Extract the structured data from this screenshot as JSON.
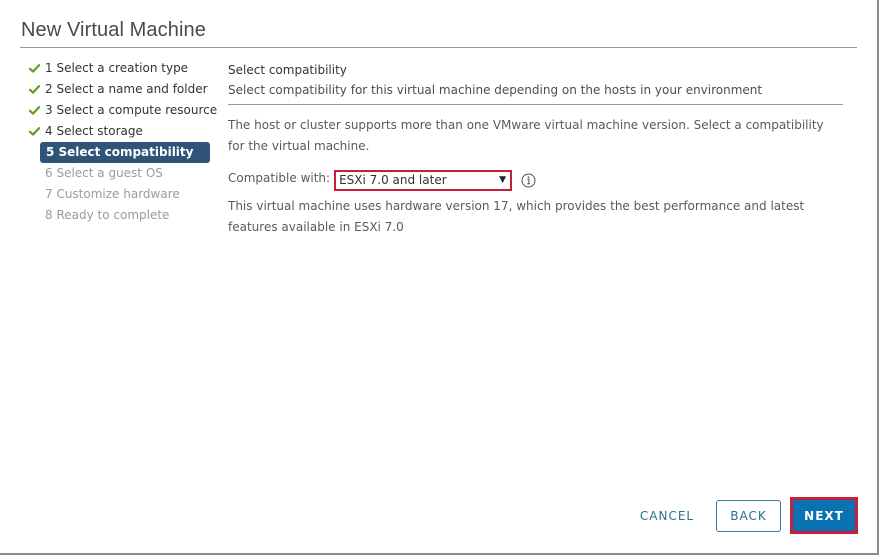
{
  "window": {
    "title": "New Virtual Machine"
  },
  "steps": [
    {
      "label": "1 Select a creation type",
      "state": "done"
    },
    {
      "label": "2 Select a name and folder",
      "state": "done"
    },
    {
      "label": "3 Select a compute resource",
      "state": "done"
    },
    {
      "label": "4 Select storage",
      "state": "done"
    },
    {
      "label": "5 Select compatibility",
      "state": "current"
    },
    {
      "label": "6 Select a guest OS",
      "state": "upcoming"
    },
    {
      "label": "7 Customize hardware",
      "state": "upcoming"
    },
    {
      "label": "8 Ready to complete",
      "state": "upcoming"
    }
  ],
  "content": {
    "title": "Select compatibility",
    "subtitle": "Select compatibility for this virtual machine depending on the hosts in your environment",
    "intro": "The host or cluster supports more than one VMware virtual machine version. Select a compatibility for the virtual machine.",
    "compat_label": "Compatible with:",
    "compat_value": "ESXi 7.0 and later",
    "compat_arrow": "▼",
    "info_icon": "info-circle-icon",
    "hw_note": "This virtual machine uses hardware version 17, which provides the best performance and latest features available in ESXi 7.0"
  },
  "footer": {
    "cancel": "CANCEL",
    "back": "BACK",
    "next": "NEXT"
  },
  "colors": {
    "accent": "#0a72b3",
    "current_step_bg": "#2f5478",
    "check_green": "#5aa220",
    "highlight_red": "#c4203a"
  }
}
